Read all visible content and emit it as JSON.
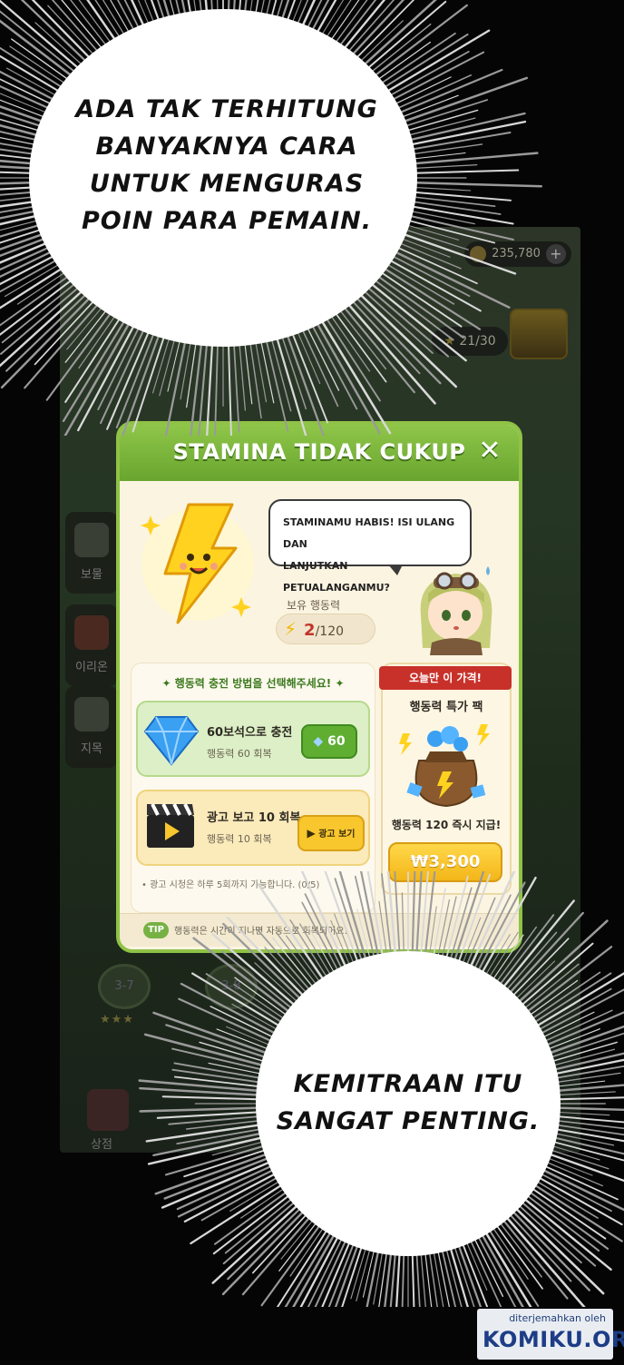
{
  "bubbles": {
    "top": {
      "lines": [
        "ADA TAK TERHITUNG",
        "BANYAKNYA CARA",
        "UNTUK MENGURAS",
        "POIN PARA PEMAIN."
      ]
    },
    "bottom": {
      "lines": [
        "KEMITRAAN ITU",
        "SANGAT PENTING."
      ]
    }
  },
  "game": {
    "resources": {
      "gold": "235,780"
    },
    "stars": "21/30",
    "sidebar": [
      "보물",
      "이리온",
      "지목"
    ],
    "stage_nodes": [
      "3-7",
      "3-8"
    ],
    "shop_label": "상점"
  },
  "popup": {
    "title": "STAMINA TIDAK CUKUP",
    "close_icon": "close-icon",
    "message_line1": "STAMINAMU HABIS! ISI ULANG DAN",
    "message_line2": "LANJUTKAN PETUALANGANMU?",
    "stamina_label": "보유 행동력",
    "stamina_current": "2",
    "stamina_max": "/120",
    "choose_title": "✦ 행동력 충전 방법을 선택해주세요! ✦",
    "options": {
      "gem": {
        "title": "60보석으로 충전",
        "sub": "행동력 60 회복",
        "button": "60",
        "icon": "diamond-icon"
      },
      "ad": {
        "title": "광고 보고 10 회복",
        "sub": "행동력 10 회복",
        "button": "광고 보기",
        "icon": "clapperboard-icon"
      }
    },
    "ad_note": "• 광고 시청은 하루 5회까지 가능합니다. (0/5)",
    "offer": {
      "ribbon": "오늘만 이 가격!",
      "title": "행동력 특가 팩",
      "desc": "행동력 120 즉시 지급!",
      "price": "₩3,300"
    },
    "tip_badge": "TIP",
    "tip_text": "행동력은 시간이 지나면 자동으로 회복되어요!"
  },
  "watermark": {
    "top": "diterjemahkan oleh",
    "main": "KOMIKU.ORG"
  },
  "colors": {
    "popup_green": "#8fc246",
    "offer_red": "#c8312a",
    "price_yellow": "#f8c62d"
  }
}
